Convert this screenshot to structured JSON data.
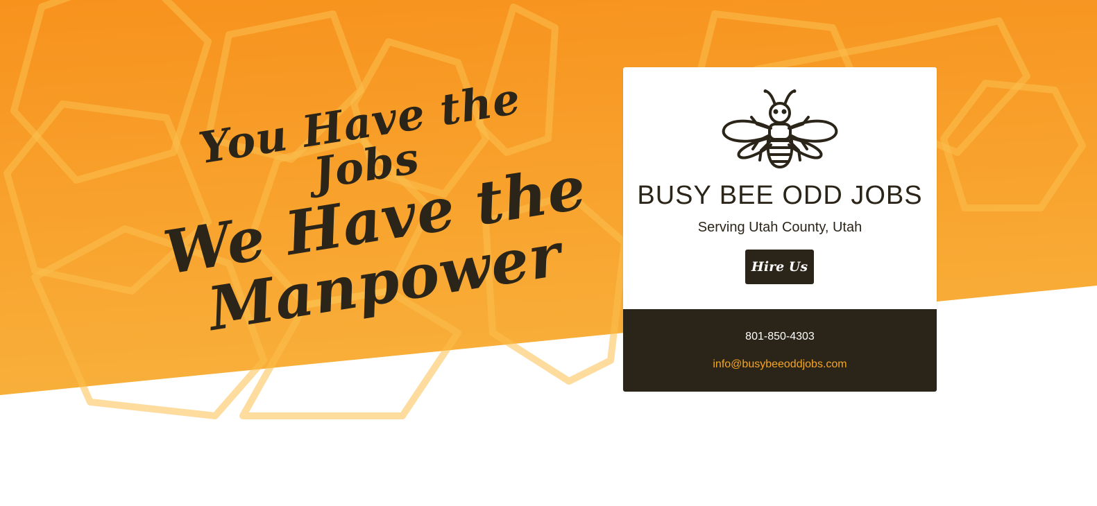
{
  "hero": {
    "headline_line1": "You Have the Jobs",
    "headline_line2": "We Have the",
    "headline_line3": "Manpower"
  },
  "card": {
    "logo_icon": "bee-icon",
    "company_name": "BUSY BEE ODD JOBS",
    "service_area": "Serving Utah County, Utah",
    "hire_button_label": "Hire Us",
    "phone": "801-850-4303",
    "email": "info@busybeeoddjobs.com"
  },
  "colors": {
    "orange_dark": "#f7931e",
    "orange_light": "#f8b13a",
    "dark_brown": "#2b2418",
    "email_accent": "#f6a623",
    "white": "#ffffff"
  }
}
